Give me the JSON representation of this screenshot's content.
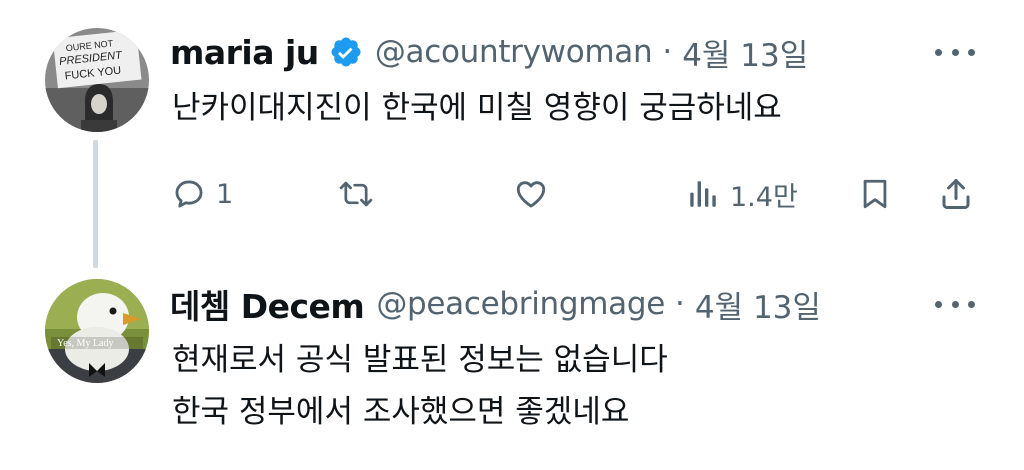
{
  "tweets": [
    {
      "display_name": "maria ju",
      "verified": true,
      "handle": "@acountrywoman",
      "separator": "·",
      "date": "4월 13일",
      "avatar_sign_text": [
        "OURE NOT",
        "PRESIDENT",
        "FUCK YOU"
      ],
      "text_lines": [
        "난카이대지진이 한국에 미칠 영향이 궁금하네요"
      ],
      "actions": {
        "reply_count": "1",
        "retweet_count": "",
        "like_count": "",
        "views_count": "1.4만"
      }
    },
    {
      "display_name": "데쳄 Decem",
      "verified": false,
      "handle": "@peacebringmage",
      "separator": "·",
      "date": "4월 13일",
      "avatar_caption": "Yes, My Lady",
      "text_lines": [
        "현재로서 공식 발표된 정보는 없습니다",
        "한국 정부에서 조사했으면 좋겠네요"
      ]
    }
  ],
  "colors": {
    "text_primary": "#0f1419",
    "text_secondary": "#536471",
    "verified_blue": "#1d9bf0",
    "thread_line": "#cfd9de"
  },
  "icons": [
    "verified-badge-icon",
    "more-icon",
    "reply-icon",
    "retweet-icon",
    "like-icon",
    "views-icon",
    "bookmark-icon",
    "share-icon"
  ]
}
